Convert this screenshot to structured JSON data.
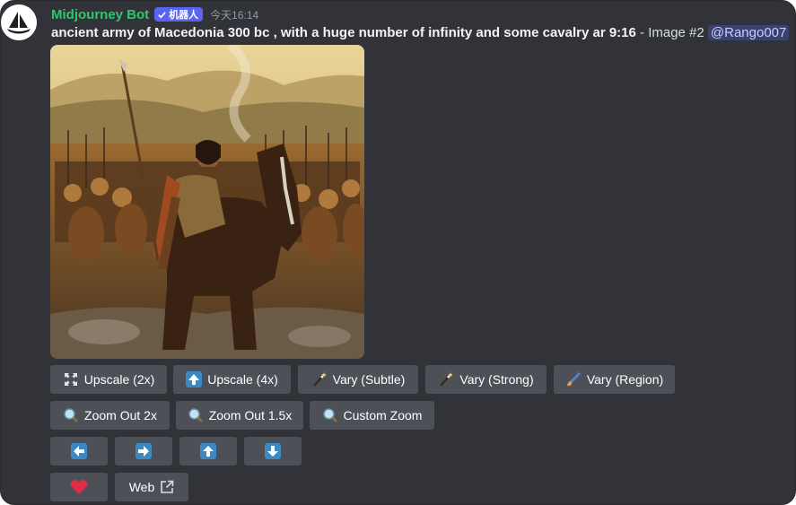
{
  "message": {
    "username": "Midjourney Bot",
    "bot_tag": "机器人",
    "timestamp": "今天16:14",
    "prompt_text": "ancient army of Macedonia 300 bc , with a huge number of infinity and some cavalry ar 9:16",
    "suffix": " - Image #2 ",
    "mention": "@Rango007"
  },
  "attachment": {
    "description": "bearded warrior on a brown horse in front of an army with spears"
  },
  "buttons": {
    "row1": [
      {
        "label": "Upscale (2x)",
        "icon": "expand-icon"
      },
      {
        "label": "Upscale (4x)",
        "icon": "up-arrow-box-icon"
      },
      {
        "label": "Vary (Subtle)",
        "icon": "magic-wand-icon"
      },
      {
        "label": "Vary (Strong)",
        "icon": "magic-wand-icon"
      },
      {
        "label": "Vary (Region)",
        "icon": "paintbrush-icon"
      }
    ],
    "row2": [
      {
        "label": "Zoom Out 2x",
        "icon": "magnifier-icon"
      },
      {
        "label": "Zoom Out 1.5x",
        "icon": "magnifier-icon"
      },
      {
        "label": "Custom Zoom",
        "icon": "magnifier-icon"
      }
    ],
    "row3": [
      {
        "icon": "arrow-left-icon"
      },
      {
        "icon": "arrow-right-icon"
      },
      {
        "icon": "arrow-up-icon"
      },
      {
        "icon": "arrow-down-icon"
      }
    ],
    "row4": [
      {
        "icon": "heart-icon"
      },
      {
        "label": "Web",
        "icon": "external-link-icon"
      }
    ]
  },
  "colors": {
    "background": "#313338",
    "username": "#2dc770",
    "bot_tag": "#5865f2",
    "button": "#4e5058",
    "mention_bg": "#3c4270"
  }
}
